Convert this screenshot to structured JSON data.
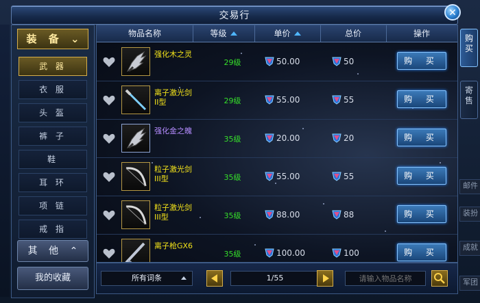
{
  "window": {
    "title": "交易行"
  },
  "sidebar": {
    "header": "装 备",
    "items": [
      "武 器",
      "衣 服",
      "头 盔",
      "裤 子",
      "鞋",
      "耳 环",
      "项 链",
      "戒 指"
    ],
    "other": "其 他",
    "favorites": "我的收藏"
  },
  "table": {
    "headers": {
      "name": "物品名称",
      "level": "等级",
      "price": "单价",
      "total": "总价",
      "action": "操作"
    },
    "rows": [
      {
        "name": "强化木之灵",
        "level": "29级",
        "price": "50.00",
        "total": "50",
        "buy": "购 买",
        "rarity": "yellow"
      },
      {
        "name": "离子激光剑II型",
        "level": "29级",
        "price": "55.00",
        "total": "55",
        "buy": "购 买",
        "rarity": "yellow"
      },
      {
        "name": "强化金之魄",
        "level": "35级",
        "price": "20.00",
        "total": "20",
        "buy": "购 买",
        "rarity": "purple"
      },
      {
        "name": "粒子激光剑III型",
        "level": "35级",
        "price": "55.00",
        "total": "55",
        "buy": "购 买",
        "rarity": "yellow"
      },
      {
        "name": "粒子激光剑III型",
        "level": "35级",
        "price": "88.00",
        "total": "88",
        "buy": "购 买",
        "rarity": "yellow"
      },
      {
        "name": "离子枪GX6",
        "level": "35级",
        "price": "100.00",
        "total": "100",
        "buy": "购 买",
        "rarity": "yellow"
      }
    ]
  },
  "footer": {
    "filter": "所有词条",
    "page": "1/55",
    "search_placeholder": "请输入物品名称"
  },
  "right_tabs": [
    "购买",
    "寄售"
  ],
  "right_side": [
    "邮件",
    "装扮",
    "成就",
    "军团"
  ],
  "colors": {
    "yellow_name": "#f2e21a",
    "purple_name": "#b58cff",
    "level_green": "#36e02a",
    "accent_gold": "#d8b04a"
  }
}
